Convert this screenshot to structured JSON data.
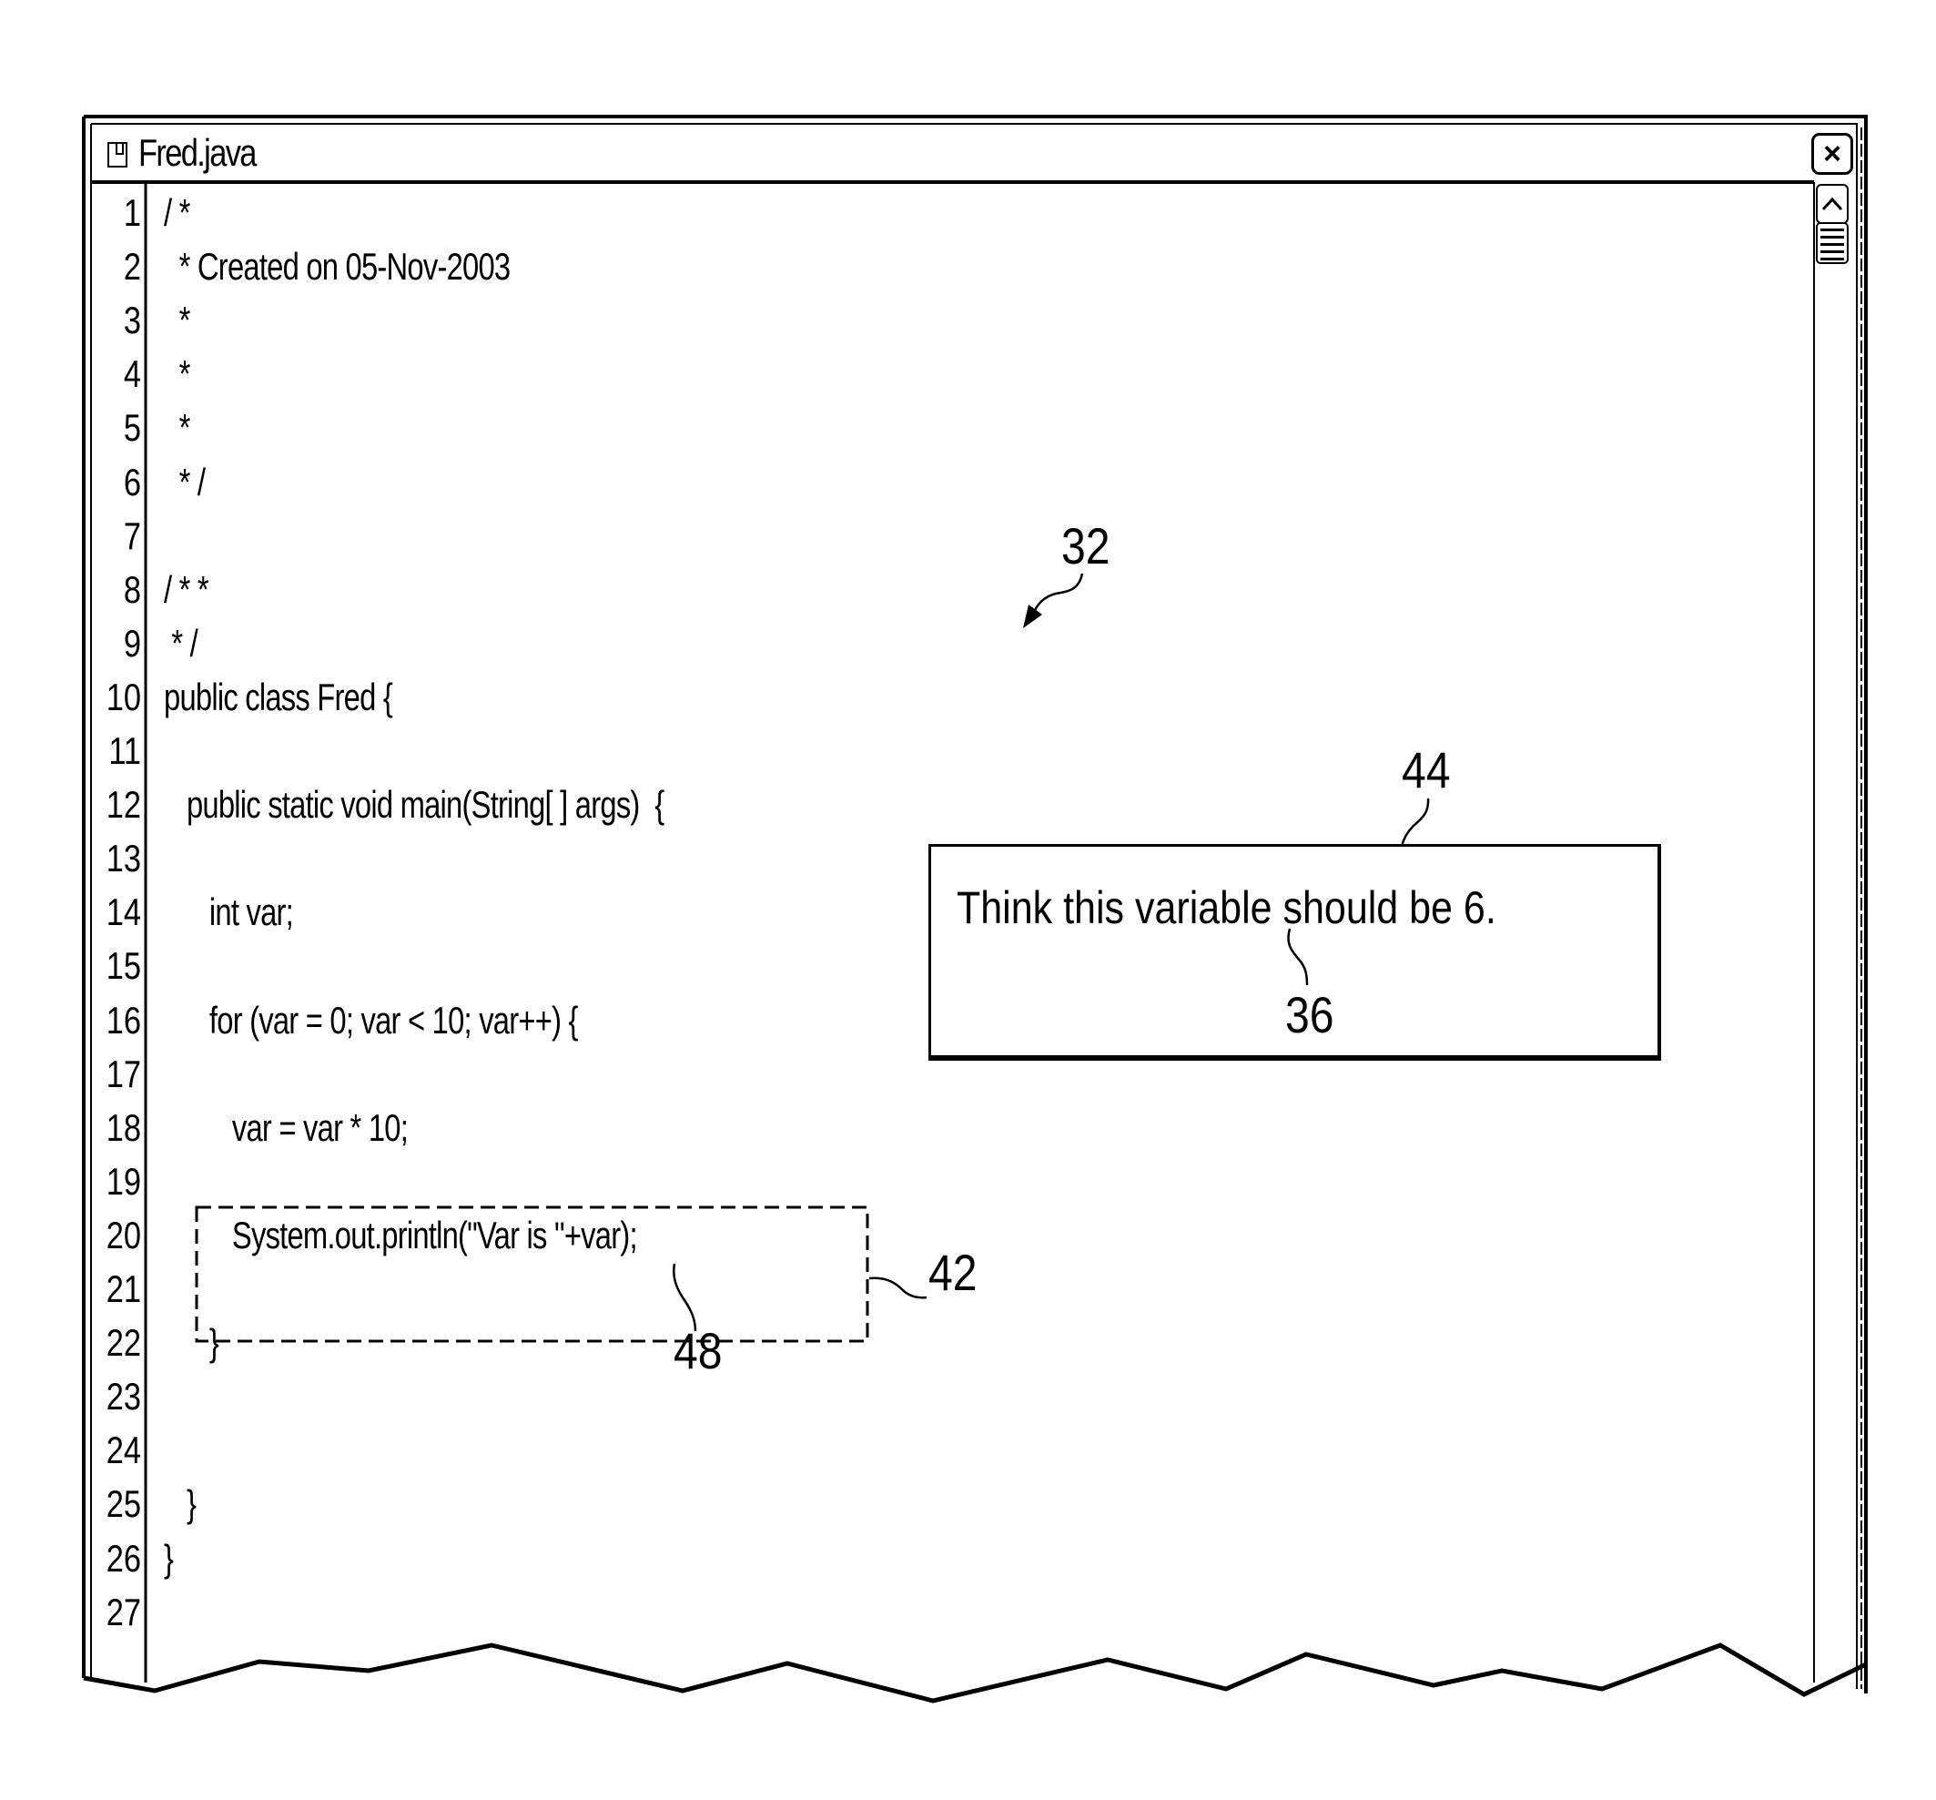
{
  "window": {
    "title": "Fred.java",
    "file_icon": "document-icon",
    "close_label": "×",
    "scroll_up_label": "^"
  },
  "editor": {
    "lines": [
      {
        "num": "1",
        "text": "/ *"
      },
      {
        "num": "2",
        "text": "  * Created on 05-Nov-2003"
      },
      {
        "num": "3",
        "text": "  *"
      },
      {
        "num": "4",
        "text": "  *"
      },
      {
        "num": "5",
        "text": "  *"
      },
      {
        "num": "6",
        "text": "  * /"
      },
      {
        "num": "7",
        "text": ""
      },
      {
        "num": "8",
        "text": "/ * *"
      },
      {
        "num": "9",
        "text": " * /"
      },
      {
        "num": "10",
        "text": "public class Fred {"
      },
      {
        "num": "11",
        "text": ""
      },
      {
        "num": "12",
        "text": "   public static void main(String[ ] args)  {"
      },
      {
        "num": "13",
        "text": ""
      },
      {
        "num": "14",
        "text": "      int var;"
      },
      {
        "num": "15",
        "text": ""
      },
      {
        "num": "16",
        "text": "      for (var = 0; var < 10; var++) {"
      },
      {
        "num": "17",
        "text": ""
      },
      {
        "num": "18",
        "text": "         var = var * 10;"
      },
      {
        "num": "19",
        "text": ""
      },
      {
        "num": "20",
        "text": "         System.out.println(\"Var is \"+var);"
      },
      {
        "num": "21",
        "text": ""
      },
      {
        "num": "22",
        "text": "      }"
      },
      {
        "num": "23",
        "text": ""
      },
      {
        "num": "24",
        "text": ""
      },
      {
        "num": "25",
        "text": "   }"
      },
      {
        "num": "26",
        "text": "}"
      },
      {
        "num": "27",
        "text": ""
      }
    ]
  },
  "comment": {
    "text": "Think this variable should be 6."
  },
  "reference_numerals": {
    "editor_window": "32",
    "comment_box": "44",
    "comment_text": "36",
    "highlighted_line": "42",
    "variable": "48"
  }
}
